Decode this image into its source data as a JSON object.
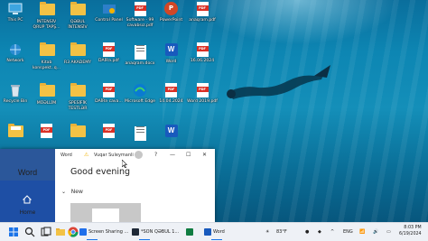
{
  "desktop": {
    "icons": [
      {
        "label": "This PC",
        "type": "pc"
      },
      {
        "label": "İNTENSİV QRUP TAPŞ...",
        "type": "folder"
      },
      {
        "label": "QƏBUL İNTENSİV",
        "type": "folder"
      },
      {
        "label": "Control Panel",
        "type": "control"
      },
      {
        "label": "Software - 99 cavabsız.pdf",
        "type": "pdf"
      },
      {
        "label": "PowerPoint",
        "type": "ppt"
      },
      {
        "label": "anaqram.pdf",
        "type": "pdf"
      },
      {
        "label": "Network",
        "type": "network"
      },
      {
        "label": "Kitab konspekt..q...",
        "type": "folder"
      },
      {
        "label": "R3 AKADEMY",
        "type": "folder"
      },
      {
        "label": "DAİRə.pdf",
        "type": "pdf"
      },
      {
        "label": "anaqram.docx",
        "type": "doc"
      },
      {
        "label": "Word",
        "type": "word"
      },
      {
        "label": "16.06.2024",
        "type": "pdf"
      },
      {
        "label": "Recycle Bin",
        "type": "bin"
      },
      {
        "label": "MÜƏLLİM",
        "type": "folder"
      },
      {
        "label": "SPESİFİK TESTLƏR",
        "type": "folder"
      },
      {
        "label": "DAİRə cava...",
        "type": "pdf"
      },
      {
        "label": "Microsoft Edge",
        "type": "edge"
      },
      {
        "label": "14.04.2024",
        "type": "pdf"
      },
      {
        "label": "Word 2019.pdf",
        "type": "pdf"
      },
      {
        "label": "",
        "type": "user"
      },
      {
        "label": "",
        "type": "pdf"
      },
      {
        "label": "",
        "type": "folder"
      },
      {
        "label": "",
        "type": "pdf"
      },
      {
        "label": "",
        "type": "doc"
      },
      {
        "label": "",
        "type": "word"
      }
    ]
  },
  "word_window": {
    "app_title": "Word",
    "user_name": "Vuqar Suleymanli",
    "help": "?",
    "sidebar_brand": "Word",
    "home_label": "Home",
    "greeting": "Good evening",
    "new_section": "New"
  },
  "taskbar": {
    "search_placeholder": "",
    "apps": [
      {
        "label": "Screen Sharing ...",
        "color": "#1f6feb"
      },
      {
        "label": "*SON QƏBUL 1...",
        "color": "#1f2937"
      },
      {
        "label": "",
        "color": "#107c41"
      },
      {
        "label": "Word",
        "color": "#185abd"
      }
    ],
    "weather": "83°F",
    "language": "ENG",
    "time": "8:03 PM",
    "date": "6/19/2024"
  },
  "colors": {
    "word_blue": "#2b579a",
    "taskbar": "#eef1f6",
    "accent": "#1a73e8"
  }
}
